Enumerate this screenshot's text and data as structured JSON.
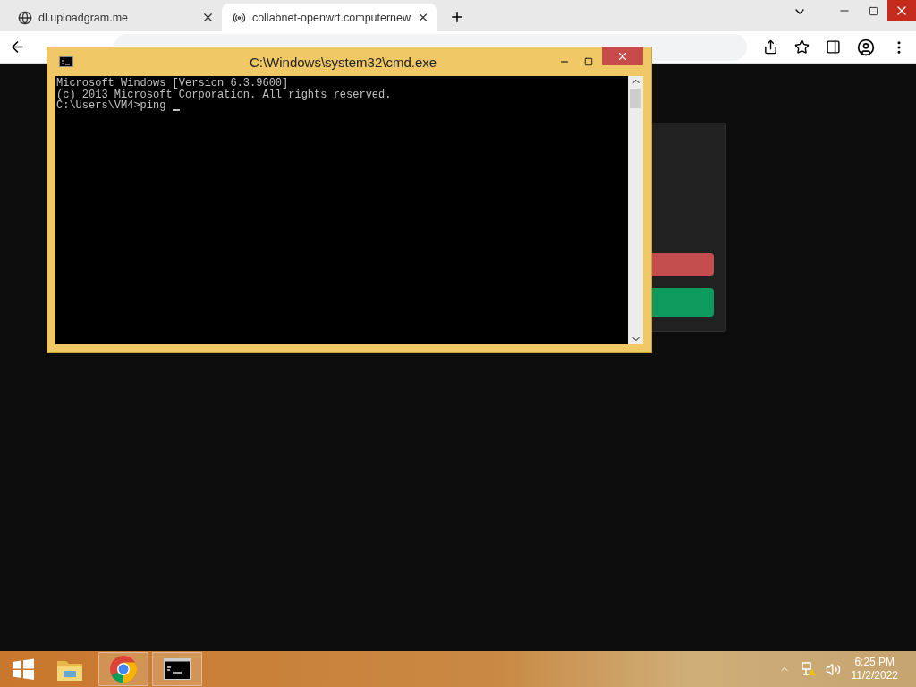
{
  "browser": {
    "tabs": [
      {
        "title": "dl.uploadgram.me",
        "selected": false
      },
      {
        "title": "collabnet-openwrt.computernew",
        "selected": true
      }
    ]
  },
  "console_window": {
    "title": "C:\\Windows\\system32\\cmd.exe",
    "lines": [
      "Microsoft Windows [Version 6.3.9600]",
      "(c) 2013 Microsoft Corporation. All rights reserved.",
      "C:\\Users\\VM4>ping "
    ]
  },
  "taskbar": {
    "apps": [
      {
        "kind": "explorer",
        "running": false
      },
      {
        "kind": "chrome",
        "running": true
      },
      {
        "kind": "console",
        "running": true
      }
    ],
    "time": "6:25 PM",
    "date": "11/2/2022"
  }
}
